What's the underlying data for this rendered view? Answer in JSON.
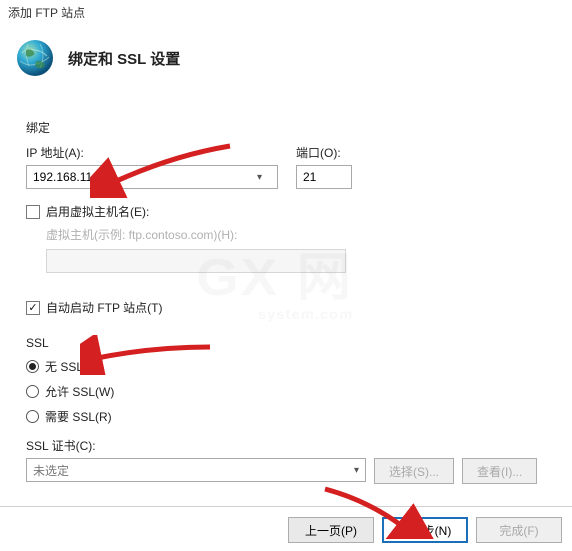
{
  "window": {
    "title": "添加 FTP 站点"
  },
  "header": {
    "title": "绑定和 SSL 设置"
  },
  "binding": {
    "section": "绑定",
    "ip_label": "IP 地址(A):",
    "ip_value": "192.168.11.202",
    "port_label": "端口(O):",
    "port_value": "21",
    "enable_vhost_label": "启用虚拟主机名(E):",
    "enable_vhost_checked": false,
    "vhost_label": "虚拟主机(示例: ftp.contoso.com)(H):",
    "vhost_value": ""
  },
  "autostart": {
    "label": "自动启动 FTP 站点(T)",
    "checked": true
  },
  "ssl": {
    "section": "SSL",
    "none_label": "无 SSL(L)",
    "allow_label": "允许 SSL(W)",
    "require_label": "需要 SSL(R)",
    "selected": "none",
    "cert_label": "SSL 证书(C):",
    "cert_value": "未选定",
    "select_btn": "选择(S)...",
    "view_btn": "查看(I)..."
  },
  "footer": {
    "prev": "上一页(P)",
    "next": "下一步(N)",
    "finish": "完成(F)"
  },
  "watermark": {
    "big": "GX  网",
    "small": "system.com"
  },
  "colors": {
    "arrow": "#d42020",
    "primary_border": "#1a6fb8"
  }
}
